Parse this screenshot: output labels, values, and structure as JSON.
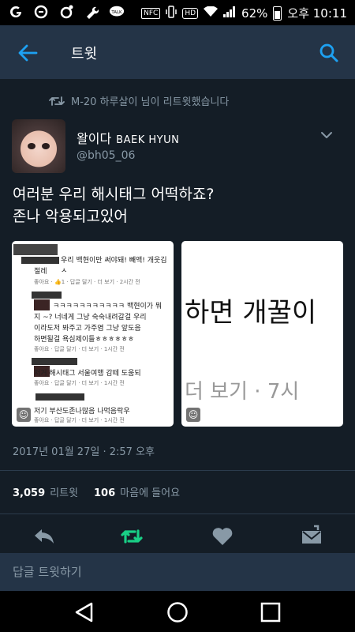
{
  "status_bar": {
    "battery": "62%",
    "time": "오후 10:11",
    "nfc": "NFC",
    "hd": "HD",
    "talk": "TALK",
    "icons": [
      "g-icon",
      "s-icon",
      "settings-icon",
      "wrench-icon",
      "kakaotalk-icon",
      "nfc-icon",
      "vibrate-icon",
      "hd-icon",
      "wifi-icon",
      "signal-icon",
      "battery-icon"
    ]
  },
  "app_bar": {
    "title": "트윗",
    "back_icon": "arrow-left-icon",
    "search_icon": "search-icon"
  },
  "tweet": {
    "retweeted_by": "M-20 하루살이 님이 리트윗했습니다",
    "display_name": "왈이다",
    "display_name_en": "BAEK HYUN",
    "handle": "@bh05_06",
    "text_line1": "여러분 우리 해시태그 어떡하죠?",
    "text_line2": "존나 악용되고있어",
    "timestamp": "2017년 01월 27일 · 2:57 오후",
    "retweets": "3,059",
    "retweets_label": "리트윗",
    "likes": "106",
    "likes_label": "마음에 들어요",
    "media1": {
      "comments": [
        {
          "text": "우리 백현이만 써야돼! 빼액! 개웃김 ㅅ",
          "sub": "절레",
          "meta": "좋아요 · 👍1 · 답글 달기 · 더 보기 · 2시간 전"
        },
        {
          "text": "ㅋㅋㅋㅋㅋㅋㅋㅋㅋㅋㅋ 백현이가 뭐",
          "sub": "지 ~? 너네게 그냥 숙숙내려갈걸 우리",
          "sub2": "이라도저 봐주고 가주염 그냥 앞도음",
          "sub3": "하면될걸 욕심제이들ㅎㅎㅎㅎㅎㅎ",
          "meta": "좋아요 · 답글 달기 · 더 보기 · 1시간 전"
        },
        {
          "text": "저거 해시태그 서울여행 감떼 도움되",
          "meta": "좋아요 · 답글 달기 · 더 보기 · 1시간 전"
        },
        {
          "text": "저기 부산도존나많음 나먹음락우",
          "meta": "좋아요 · 답글 달기 · 더 보기 · 1시간 전"
        }
      ]
    },
    "media2": {
      "big_text": "하면 개꿀이",
      "small_text": "더 보기 · 7시"
    }
  },
  "reply_bar": {
    "placeholder": "답글 트윗하기"
  },
  "colors": {
    "background": "#141d26",
    "app_bar": "#243447",
    "accent": "#1da1f2",
    "retweet_active": "#19cf86",
    "muted": "#8899a6"
  }
}
